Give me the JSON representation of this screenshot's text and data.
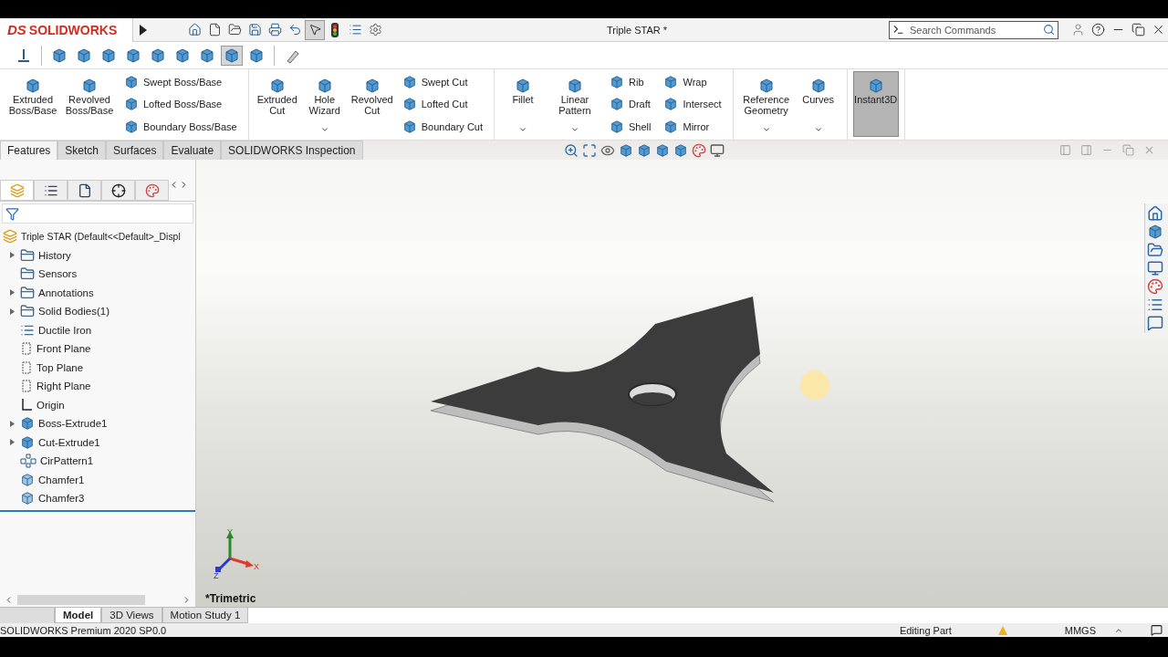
{
  "app": {
    "logo_mark": "DS",
    "logo_text": "SOLIDWORKS",
    "title": "Triple STAR *",
    "search": {
      "placeholder": "Search Commands"
    },
    "select_tool": {
      "selected": true
    }
  },
  "display_buttons": [
    {
      "kind": "normal",
      "selected": false
    },
    {
      "kind": "cube",
      "selected": false
    },
    {
      "kind": "cube",
      "selected": false
    },
    {
      "kind": "cube",
      "selected": false
    },
    {
      "kind": "cube",
      "selected": false
    },
    {
      "kind": "cube",
      "selected": false
    },
    {
      "kind": "cube",
      "selected": false
    },
    {
      "kind": "cube",
      "selected": false
    },
    {
      "kind": "cube",
      "selected": true
    },
    {
      "kind": "cube",
      "selected": false
    },
    {
      "kind": "tool",
      "selected": false
    }
  ],
  "ribbon": {
    "groups": [
      {
        "columns": [
          {
            "kind": "large",
            "label": "Extruded Boss/Base",
            "dropdown": false,
            "selected": false
          },
          {
            "kind": "large",
            "label": "Revolved Boss/Base",
            "dropdown": false,
            "selected": false
          },
          {
            "kind": "stack",
            "items": [
              "Swept Boss/Base",
              "Lofted Boss/Base",
              "Boundary Boss/Base"
            ]
          }
        ]
      },
      {
        "columns": [
          {
            "kind": "large",
            "label": "Extruded Cut",
            "dropdown": false,
            "selected": false
          },
          {
            "kind": "large",
            "label": "Hole Wizard",
            "dropdown": true,
            "selected": false
          },
          {
            "kind": "large",
            "label": "Revolved Cut",
            "dropdown": false,
            "selected": false
          },
          {
            "kind": "stack",
            "items": [
              "Swept Cut",
              "Lofted Cut",
              "Boundary Cut"
            ]
          }
        ]
      },
      {
        "columns": [
          {
            "kind": "large",
            "label": "Fillet",
            "dropdown": true,
            "selected": false
          },
          {
            "kind": "large",
            "label": "Linear Pattern",
            "dropdown": true,
            "selected": false
          },
          {
            "kind": "stack",
            "items": [
              "Rib",
              "Draft",
              "Shell"
            ]
          },
          {
            "kind": "stack",
            "items": [
              "Wrap",
              "Intersect",
              "Mirror"
            ]
          }
        ]
      },
      {
        "columns": [
          {
            "kind": "large",
            "label": "Reference Geometry",
            "dropdown": true,
            "selected": false
          },
          {
            "kind": "large",
            "label": "Curves",
            "dropdown": true,
            "selected": false
          }
        ]
      },
      {
        "columns": [
          {
            "kind": "large",
            "label": "Instant3D",
            "dropdown": false,
            "selected": true
          }
        ]
      }
    ]
  },
  "command_tabs": [
    {
      "label": "Features",
      "selected": true
    },
    {
      "label": "Sketch",
      "selected": false
    },
    {
      "label": "Surfaces",
      "selected": false
    },
    {
      "label": "Evaluate",
      "selected": false
    },
    {
      "label": "SOLIDWORKS Inspection",
      "selected": false
    }
  ],
  "tree": {
    "root": "Triple STAR  (Default<<Default>_Displ",
    "items": [
      {
        "label": "History",
        "kind": "folder",
        "expanded": false
      },
      {
        "label": "Sensors",
        "kind": "folder"
      },
      {
        "label": "Annotations",
        "kind": "folder",
        "expanded": false
      },
      {
        "label": "Solid Bodies(1)",
        "kind": "folder",
        "expanded": false
      },
      {
        "label": "Ductile Iron",
        "kind": "material"
      },
      {
        "label": "Front Plane",
        "kind": "plane"
      },
      {
        "label": "Top Plane",
        "kind": "plane"
      },
      {
        "label": "Right Plane",
        "kind": "plane"
      },
      {
        "label": "Origin",
        "kind": "origin"
      },
      {
        "label": "Boss-Extrude1",
        "kind": "feature",
        "expanded": false
      },
      {
        "label": "Cut-Extrude1",
        "kind": "feature",
        "expanded": false
      },
      {
        "label": "CirPattern1",
        "kind": "pattern"
      },
      {
        "label": "Chamfer1",
        "kind": "chamfer"
      },
      {
        "label": "Chamfer3",
        "kind": "chamfer"
      }
    ]
  },
  "viewport": {
    "view_label": "*Trimetric",
    "axes": [
      "X",
      "Y",
      "Z"
    ]
  },
  "bottom_tabs": [
    {
      "label": "Model",
      "selected": true
    },
    {
      "label": "3D Views",
      "selected": false
    },
    {
      "label": "Motion Study 1",
      "selected": false
    }
  ],
  "status_bar": {
    "product": "SOLIDWORKS Premium 2020 SP0.0",
    "mode": "Editing Part",
    "units": "MMGS"
  }
}
